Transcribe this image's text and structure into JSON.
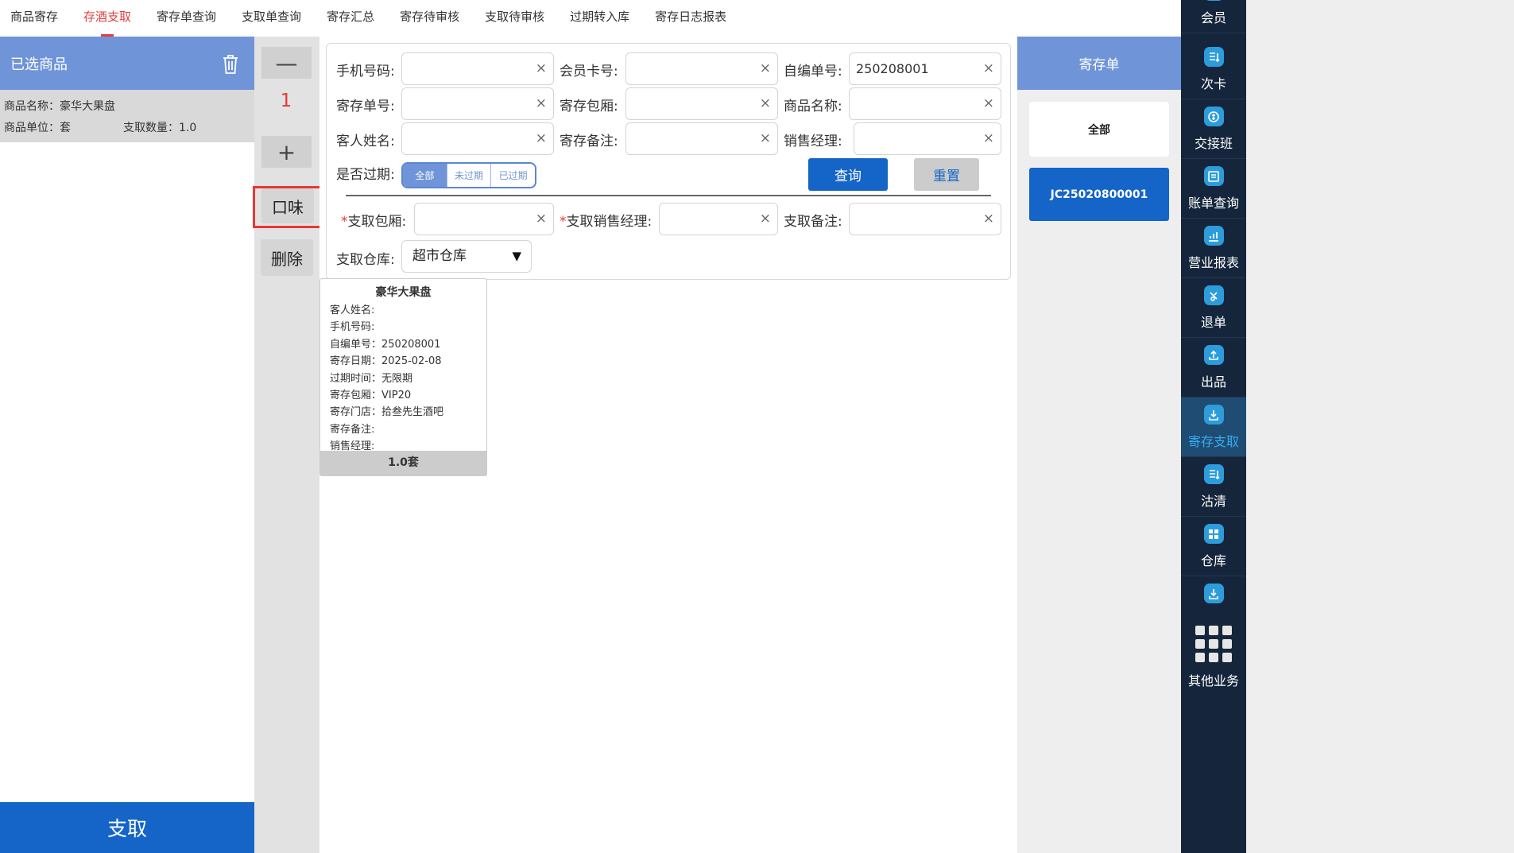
{
  "tabs": [
    {
      "label": "商品寄存",
      "active": false
    },
    {
      "label": "存酒支取",
      "active": true
    },
    {
      "label": "寄存单查询",
      "active": false
    },
    {
      "label": "支取单查询",
      "active": false
    },
    {
      "label": "寄存汇总",
      "active": false
    },
    {
      "label": "寄存待审核",
      "active": false
    },
    {
      "label": "支取待审核",
      "active": false
    },
    {
      "label": "过期转入库",
      "active": false
    },
    {
      "label": "寄存日志报表",
      "active": false
    }
  ],
  "left": {
    "title": "已选商品",
    "item_name": "商品名称：豪华大果盘",
    "item_unit": "商品单位：套",
    "item_qty": "支取数量：1.0",
    "withdraw_label": "支取"
  },
  "controls": {
    "minus": "—",
    "qty": "1",
    "plus": "+",
    "flavor_label": "口味",
    "delete_label": "删除"
  },
  "form": {
    "phone_label": "手机号码:",
    "member_label": "会员卡号:",
    "selfno_label": "自编单号:",
    "selfno_value": "250208001",
    "depositno_label": "寄存单号:",
    "room_label": "寄存包厢:",
    "goods_label": "商品名称:",
    "guest_label": "客人姓名:",
    "remark_label": "寄存备注:",
    "manager_label": "销售经理:",
    "expired_label": "是否过期:",
    "seg_options": [
      "全部",
      "未过期",
      "已过期"
    ],
    "query_label": "查询",
    "reset_label": "重置",
    "w_room_label": "支取包厢:",
    "w_manager_label": "支取销售经理:",
    "w_remark_label": "支取备注:",
    "warehouse_label": "支取仓库:",
    "warehouse_value": "超市仓库",
    "clear_glyph": "×",
    "required_mark": "*",
    "dropdown_glyph": "▼"
  },
  "card": {
    "title": "豪华大果盘",
    "lines": [
      "客人姓名:",
      "手机号码:",
      "自编单号：250208001",
      "寄存日期：2025-02-08",
      "过期时间：无限期",
      "寄存包厢：VIP20",
      "寄存门店：拾叁先生酒吧",
      "寄存备注:",
      "销售经理:"
    ],
    "footer": "1.0套"
  },
  "right": {
    "title": "寄存单",
    "all_label": "全部",
    "order_no": "JC25020800001"
  },
  "sidenav": [
    {
      "label": "会员",
      "icon": "member-icon"
    },
    {
      "label": "次卡",
      "icon": "card-icon"
    },
    {
      "label": "交接班",
      "icon": "shift-icon"
    },
    {
      "label": "账单查询",
      "icon": "bill-icon"
    },
    {
      "label": "营业报表",
      "icon": "report-icon"
    },
    {
      "label": "退单",
      "icon": "refund-icon"
    },
    {
      "label": "出品",
      "icon": "dispatch-icon"
    },
    {
      "label": "寄存支取",
      "icon": "deposit-icon",
      "active": true
    },
    {
      "label": "沽清",
      "icon": "soldout-icon"
    },
    {
      "label": "仓库",
      "icon": "warehouse-icon"
    },
    {
      "label": "",
      "icon": "download-icon"
    },
    {
      "label": "其他业务",
      "icon": "grid-icon"
    }
  ],
  "colors": {
    "accent_blue": "#1565c8",
    "header_blue": "#6f95d8",
    "active_red": "#e04040",
    "nav_bg": "#15263c"
  }
}
